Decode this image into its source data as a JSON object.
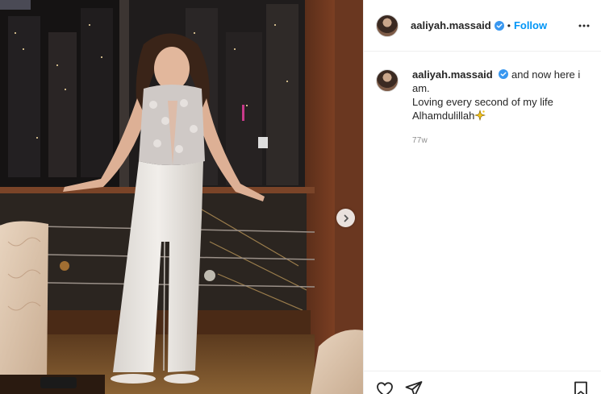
{
  "post": {
    "author": {
      "username": "aaliyah.massaid",
      "verified": true
    },
    "follow_label": "Follow",
    "separator": "•",
    "caption": {
      "username": "aaliyah.massaid",
      "text_line1": "and now here i am.",
      "text_line2": "Loving every second of my life",
      "text_line3": "Alhamdulillah",
      "emoji": "sparkles-star"
    },
    "timestamp": "77w",
    "photo": {
      "description_icon": "photo-content",
      "next_icon": "chevron-right-icon"
    },
    "actions": [
      "like-icon",
      "share-icon",
      "save-icon"
    ],
    "colors": {
      "follow_blue": "#0095f6",
      "verified_blue": "#3897f0",
      "muted_text": "#8e8e8e",
      "border": "#efefef"
    }
  }
}
